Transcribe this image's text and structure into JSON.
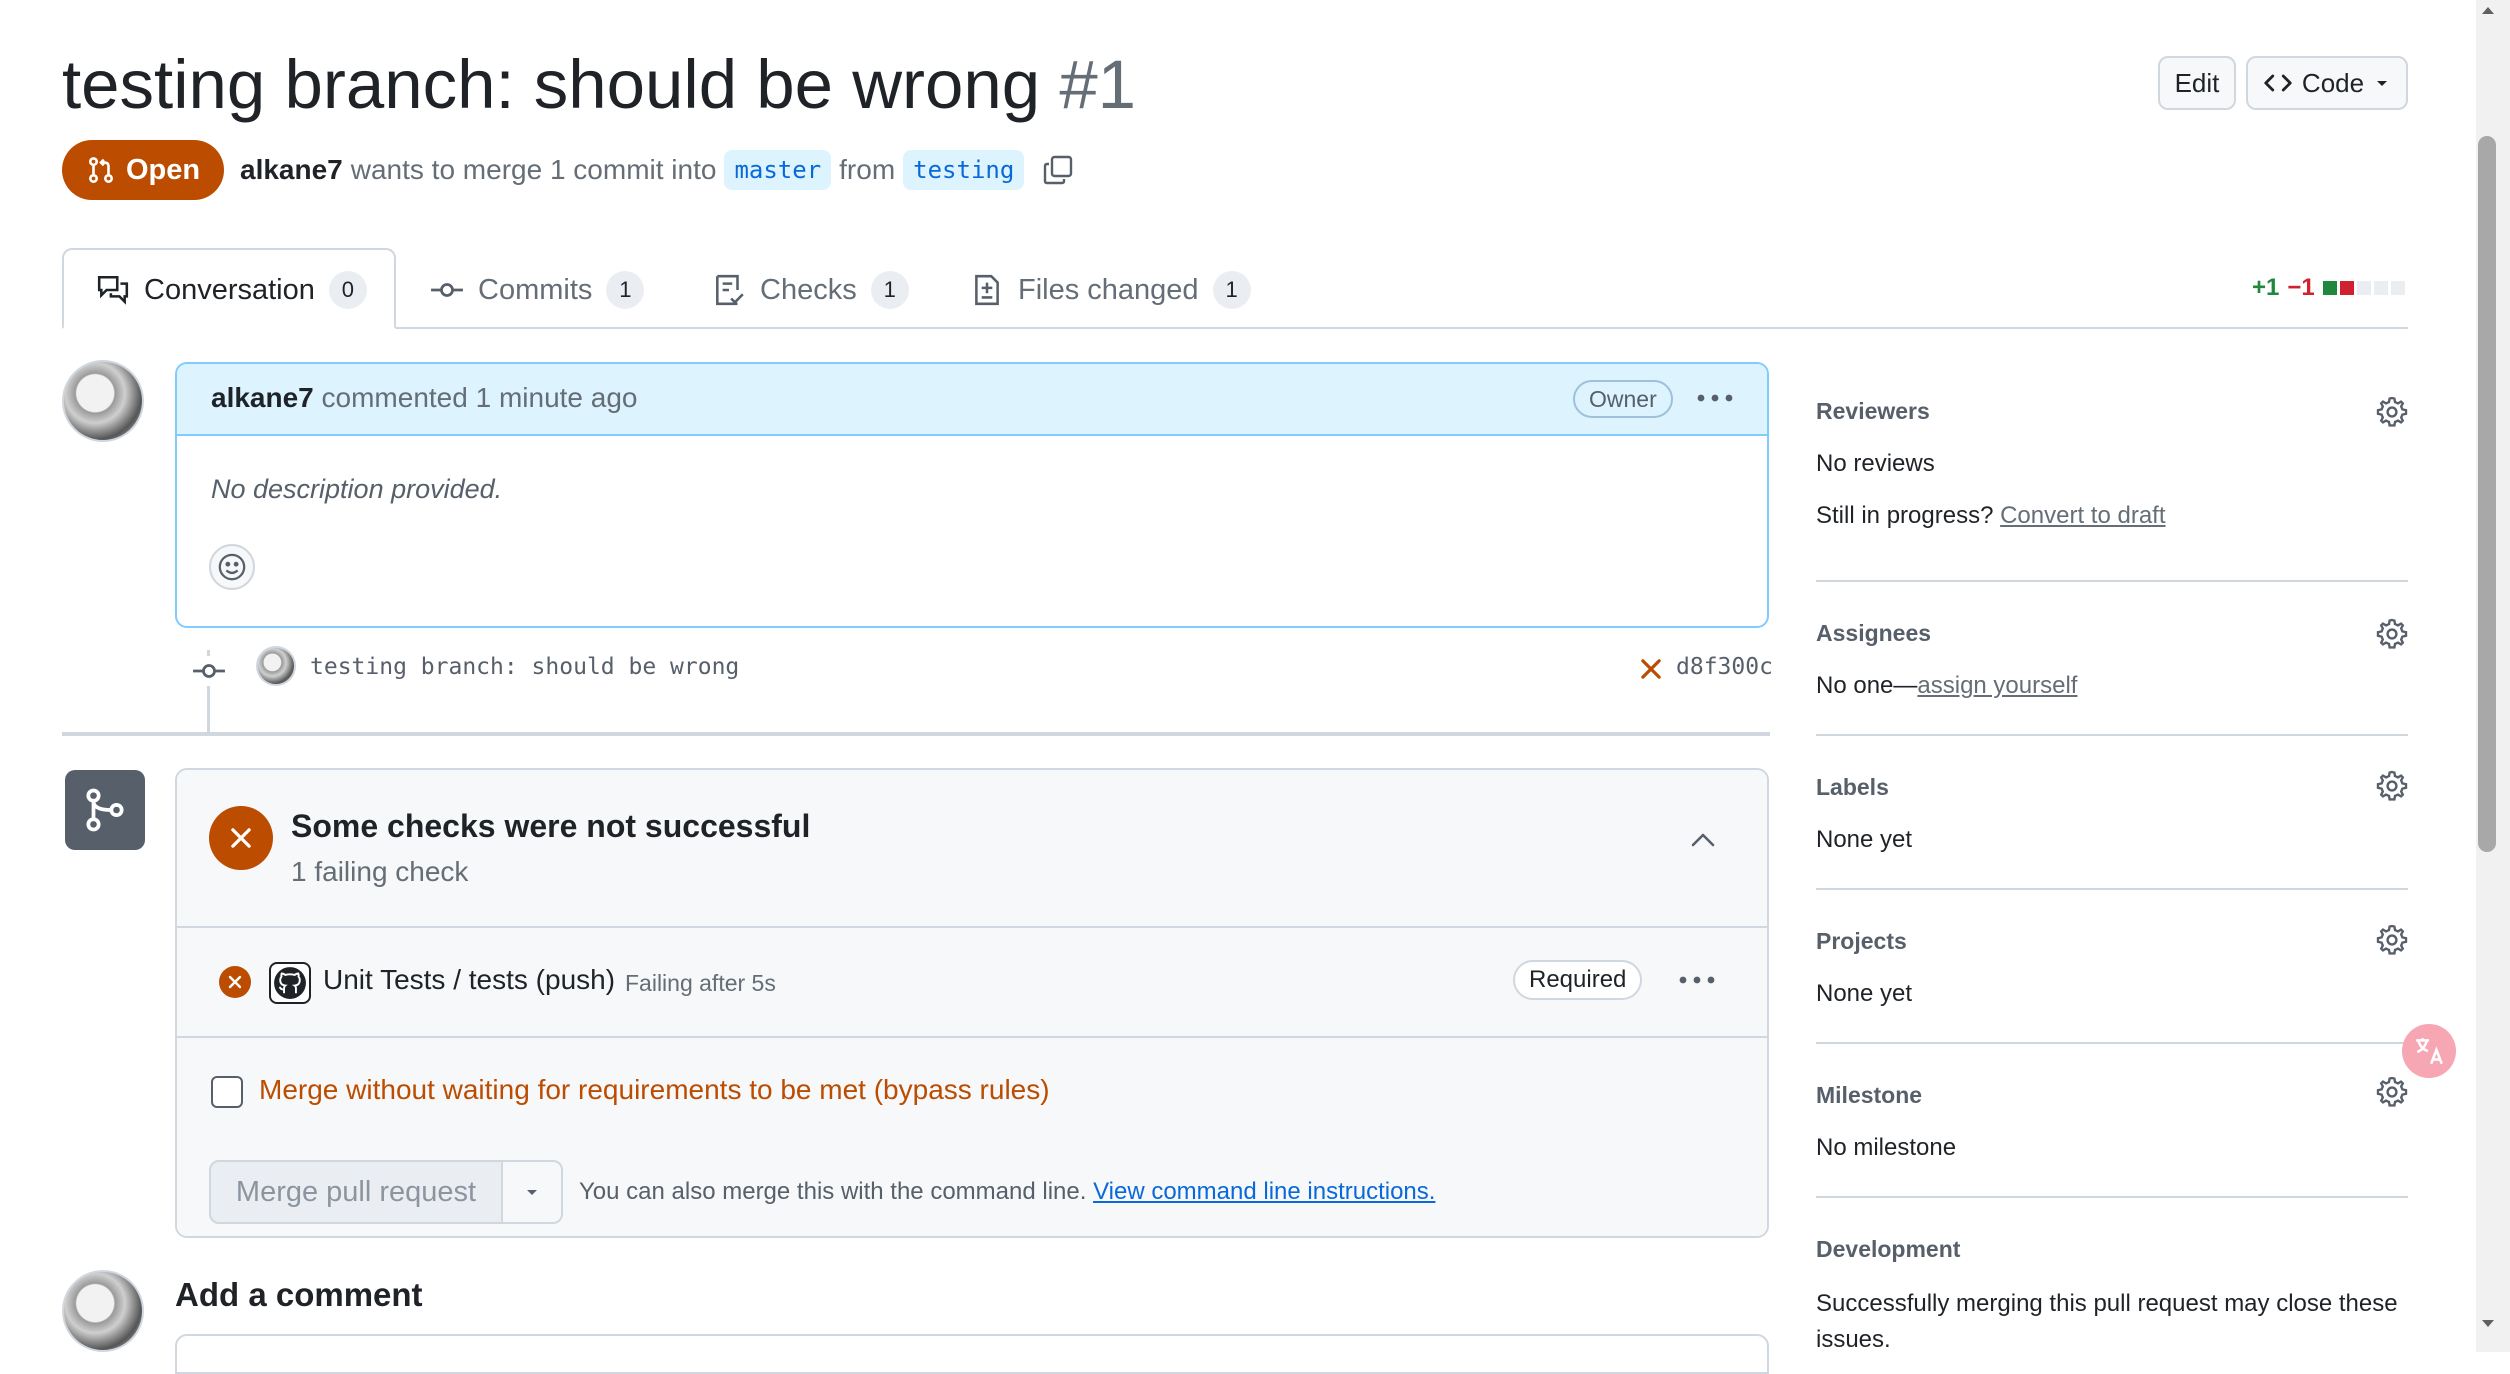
{
  "pr": {
    "title": "testing branch: should be wrong",
    "number": "#1",
    "state": "Open",
    "author": "alkane7",
    "merge_text": "wants to merge 1 commit into",
    "base_branch": "master",
    "from_text": "from",
    "head_branch": "testing"
  },
  "header_buttons": {
    "edit": "Edit",
    "code": "Code"
  },
  "tabs": [
    {
      "label": "Conversation",
      "count": "0",
      "icon": "comment-discussion-icon"
    },
    {
      "label": "Commits",
      "count": "1",
      "icon": "git-commit-icon"
    },
    {
      "label": "Checks",
      "count": "1",
      "icon": "checklist-icon"
    },
    {
      "label": "Files changed",
      "count": "1",
      "icon": "file-diff-icon"
    }
  ],
  "diffstat": {
    "additions": "+1",
    "deletions": "−1",
    "add_color": "#1f883d",
    "del_color": "#cf222e"
  },
  "comment": {
    "author": "alkane7",
    "action": "commented",
    "time": "1 minute ago",
    "badge": "Owner",
    "body": "No description provided."
  },
  "commit": {
    "message": "testing branch: should be wrong",
    "sha": "d8f300c",
    "status": "failed"
  },
  "merge_box": {
    "title": "Some checks were not successful",
    "subtitle": "1 failing check",
    "check_name": "Unit Tests / tests (push)",
    "check_status": "Failing after 5s",
    "required": "Required",
    "bypass_label": "Merge without waiting for requirements to be met (bypass rules)",
    "merge_button": "Merge pull request",
    "cli_text": "You can also merge this with the command line.",
    "cli_link": "View command line instructions."
  },
  "add_comment": "Add a comment",
  "sidebar": {
    "reviewers": {
      "heading": "Reviewers",
      "value": "No reviews",
      "progress_text": "Still in progress?",
      "draft_link": "Convert to draft"
    },
    "assignees": {
      "heading": "Assignees",
      "value": "No one—",
      "link": "assign yourself"
    },
    "labels": {
      "heading": "Labels",
      "value": "None yet"
    },
    "projects": {
      "heading": "Projects",
      "value": "None yet"
    },
    "milestone": {
      "heading": "Milestone",
      "value": "No milestone"
    },
    "development": {
      "heading": "Development",
      "value": "Successfully merging this pull request may close these issues."
    }
  },
  "colors": {
    "accent": "#0969da",
    "danger_orange": "#bc4c00",
    "comment_header": "#ddf4ff"
  }
}
